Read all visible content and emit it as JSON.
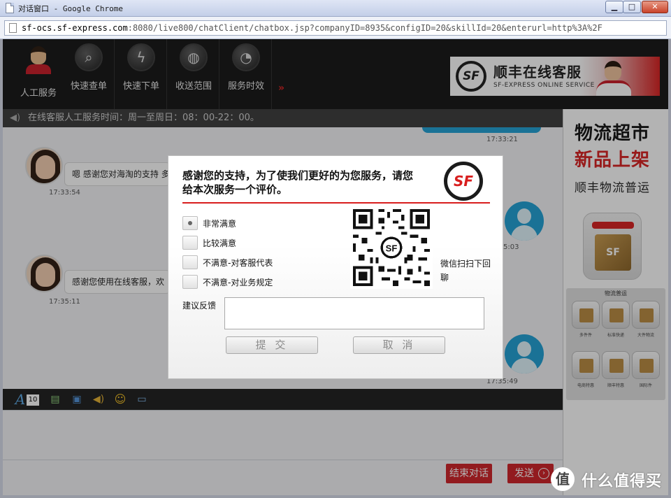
{
  "window": {
    "title": "对话窗口 - Google Chrome",
    "minimize": "▁",
    "maximize": "□",
    "close": "✕"
  },
  "address": {
    "host": "sf-ocs.sf-express.com",
    "rest": ":8080/live800/chatClient/chatbox.jsp?companyID=8935&configID=20&skillId=20&enterurl=http%3A%2F"
  },
  "nav": {
    "items": [
      {
        "label": "人工服务",
        "icon": "agent-avatar-icon"
      },
      {
        "label": "快速查单",
        "icon": "search-order-icon"
      },
      {
        "label": "快速下单",
        "icon": "quick-order-icon"
      },
      {
        "label": "收送范围",
        "icon": "globe-icon"
      },
      {
        "label": "服务时效",
        "icon": "truck-clock-icon"
      }
    ],
    "more": "»"
  },
  "banner": {
    "logo": "SF",
    "title": "顺丰在线客服",
    "subtitle": "SF-EXPRESS ONLINE SERVICE"
  },
  "notice": {
    "icon": "speaker-icon",
    "text": "在线客服人工服务时间：周一至周日：08：00-22：00。"
  },
  "chat": {
    "messages": [
      {
        "time": "17:33:21",
        "from": "user"
      },
      {
        "time": "17:33:54",
        "from": "agent",
        "text": "嗯 感谢您对海淘的支持 多"
      },
      {
        "time": "17:35:03",
        "from": "user",
        "time_visible": "5:03"
      },
      {
        "time": "17:35:11",
        "from": "agent",
        "text": "感谢您使用在线客服，欢"
      },
      {
        "time": "17:35:49",
        "from": "user"
      }
    ]
  },
  "toolbar": {
    "font_size": "10"
  },
  "input": {
    "end_button": "结束对话",
    "send_button": "发送",
    "send_arrow": "›"
  },
  "side_ad": {
    "line1": "物流超市",
    "line2": "新品上架",
    "line3": "顺丰物流普运",
    "box_label": "SF",
    "panel_title": "物流普运",
    "tiles": [
      "",
      "",
      "",
      "",
      "",
      ""
    ],
    "tile_labels": [
      "多件件",
      "标准快递",
      "大件物流",
      "电商特惠",
      "顺丰特惠",
      "国际件"
    ]
  },
  "modal": {
    "title": "感谢您的支持，为了使我们更好的为您服务，请您给本次服务一个评价。",
    "logo": "SF",
    "options": [
      {
        "label": "非常满意",
        "selected": true
      },
      {
        "label": "比较满意",
        "selected": false
      },
      {
        "label": "不满意-对客服代表",
        "selected": false
      },
      {
        "label": "不满意-对业务规定",
        "selected": false
      }
    ],
    "qr_caption": "微信扫扫下回聊",
    "feedback_label": "建议反馈",
    "feedback_value": "",
    "submit": "提 交",
    "cancel": "取 消"
  },
  "watermark": {
    "icon": "值",
    "text": "什么值得买"
  },
  "colors": {
    "brand_red": "#d81e1e",
    "nav_bg": "#141414",
    "user_blue": "#1e9fd4"
  }
}
